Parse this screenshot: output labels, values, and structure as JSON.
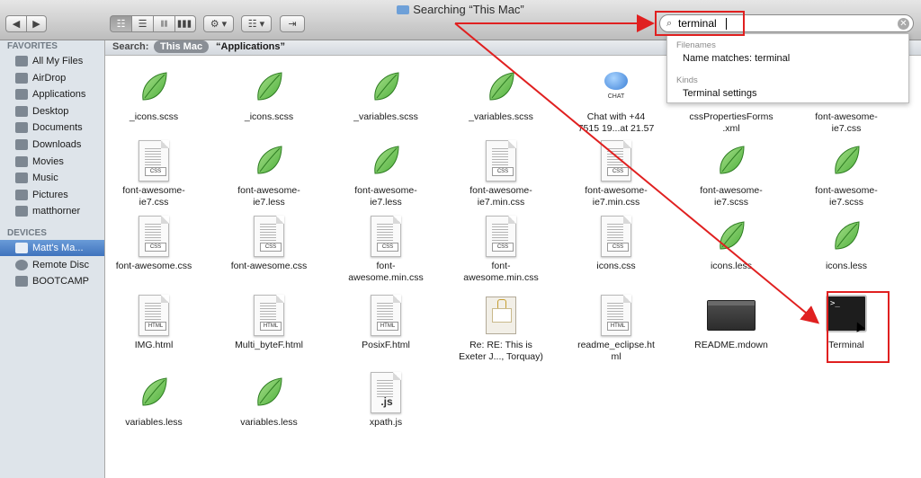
{
  "window": {
    "title": "Searching “This Mac”"
  },
  "toolbar": {
    "back_icon": "◀",
    "forward_icon": "▶",
    "view_icons": [
      "☷",
      "☰",
      "⫼⫼",
      "▋▋▋"
    ],
    "action_icon": "⚙ ▾",
    "arrange_icon": "☷ ▾",
    "share_icon": "⇥"
  },
  "search": {
    "value": "terminal",
    "clear_icon": "✕",
    "magnifier": "⌕"
  },
  "dropdown": {
    "filenames_header": "Filenames",
    "name_matches": "Name matches: terminal",
    "kinds_header": "Kinds",
    "terminal_settings": "Terminal settings"
  },
  "sidebar": {
    "favorites_header": "FAVORITES",
    "favorites": [
      "All My Files",
      "AirDrop",
      "Applications",
      "Desktop",
      "Documents",
      "Downloads",
      "Movies",
      "Music",
      "Pictures",
      "matthorner"
    ],
    "devices_header": "DEVICES",
    "devices": [
      "Matt's Ma...",
      "Remote Disc",
      "BOOTCAMP"
    ]
  },
  "scope": {
    "label": "Search:",
    "this_mac": "This Mac",
    "applications": "“Applications”"
  },
  "files": [
    {
      "name": "_icons.scss",
      "icon": "leaf"
    },
    {
      "name": "_icons.scss",
      "icon": "leaf"
    },
    {
      "name": "_variables.scss",
      "icon": "leaf"
    },
    {
      "name": "_variables.scss",
      "icon": "leaf"
    },
    {
      "name": "Chat with +44\n7515 19...at 21.57",
      "icon": "chat"
    },
    {
      "name": "cssPropertiesForms\n.xml",
      "icon": "none"
    },
    {
      "name": "font-awesome-\nie7.css",
      "icon": "none"
    },
    {
      "name": "font-awesome-\nie7.css",
      "icon": "css"
    },
    {
      "name": "font-awesome-\nie7.less",
      "icon": "leaf"
    },
    {
      "name": "font-awesome-\nie7.less",
      "icon": "leaf"
    },
    {
      "name": "font-awesome-\nie7.min.css",
      "icon": "css"
    },
    {
      "name": "font-awesome-\nie7.min.css",
      "icon": "css"
    },
    {
      "name": "font-awesome-\nie7.scss",
      "icon": "leaf"
    },
    {
      "name": "font-awesome-\nie7.scss",
      "icon": "leaf"
    },
    {
      "name": "font-awesome.css",
      "icon": "css"
    },
    {
      "name": "font-awesome.css",
      "icon": "css"
    },
    {
      "name": "font-\nawesome.min.css",
      "icon": "css"
    },
    {
      "name": "font-\nawesome.min.css",
      "icon": "css"
    },
    {
      "name": "icons.css",
      "icon": "css"
    },
    {
      "name": "icons.less",
      "icon": "leaf"
    },
    {
      "name": "icons.less",
      "icon": "leaf"
    },
    {
      "name": "IMG.html",
      "icon": "html"
    },
    {
      "name": "Multi_byteF.html",
      "icon": "html"
    },
    {
      "name": "PosixF.html",
      "icon": "html"
    },
    {
      "name": "Re: RE: This is\nExeter J..., Torquay)",
      "icon": "mail"
    },
    {
      "name": "readme_eclipse.ht\nml",
      "icon": "html"
    },
    {
      "name": "README.mdown",
      "icon": "dark"
    },
    {
      "name": "Terminal",
      "icon": "terminal"
    },
    {
      "name": "variables.less",
      "icon": "leaf"
    },
    {
      "name": "variables.less",
      "icon": "leaf"
    },
    {
      "name": "xpath.js",
      "icon": "js"
    }
  ],
  "badges": {
    "css": "CSS",
    "html": "HTML",
    "js": ".js",
    "chat": "CHAT",
    "terminal_prompt": ">_"
  },
  "colors": {
    "annotation_red": "#e02020",
    "selection_blue": "#3f73bd",
    "leaf_green": "#4caf3a"
  }
}
